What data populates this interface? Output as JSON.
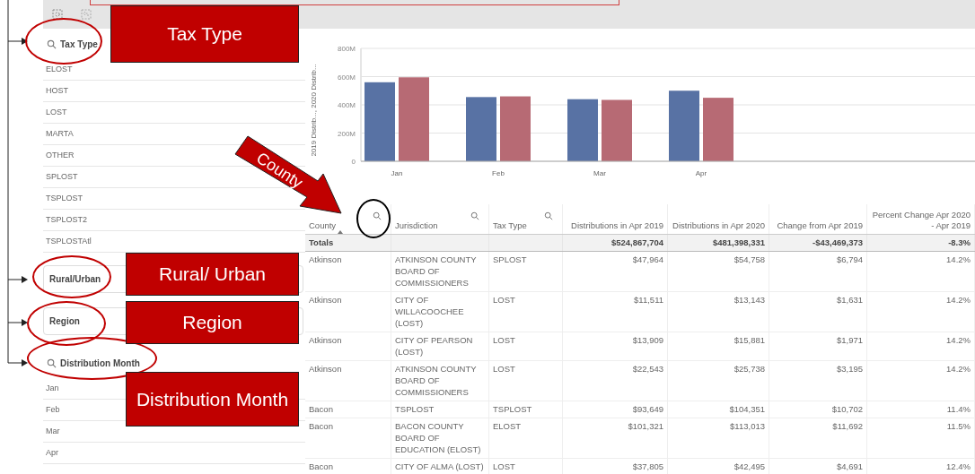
{
  "filters": [
    {
      "kind": "list",
      "title": "Tax Type",
      "items": [
        "ELOST",
        "HOST",
        "LOST",
        "MARTA",
        "OTHER",
        "SPLOST",
        "TSPLOST",
        "TSPLOST2",
        "TSPLOSTAtl"
      ]
    },
    {
      "kind": "dropdown",
      "title": "Rural/Urban"
    },
    {
      "kind": "dropdown",
      "title": "Region"
    },
    {
      "kind": "list",
      "title": "Distribution Month",
      "items": [
        "Jan",
        "Feb",
        "Mar",
        "Apr"
      ]
    }
  ],
  "chart": {
    "chart_data": {
      "type": "bar",
      "ylabel": "2019 Distrib..., 2020 Distrib...",
      "categories": [
        "Jan",
        "Feb",
        "Mar",
        "Apr"
      ],
      "series": [
        {
          "color": "#5872a4",
          "values": [
            560,
            455,
            440,
            500
          ]
        },
        {
          "color": "#b76a74",
          "values": [
            595,
            460,
            435,
            450
          ]
        }
      ],
      "ylim": [
        0,
        800
      ],
      "grid": true,
      "yticks": [
        {
          "value": 0,
          "label": "0"
        },
        {
          "value": 200,
          "label": "200M"
        },
        {
          "value": 400,
          "label": "400M"
        },
        {
          "value": 600,
          "label": "600M"
        },
        {
          "value": 800,
          "label": "800M"
        }
      ]
    }
  },
  "table": {
    "columns": [
      {
        "label": "County",
        "kind": "text",
        "search": true,
        "sorted": true
      },
      {
        "label": "Jurisdiction",
        "kind": "text",
        "search": true,
        "sorted": false
      },
      {
        "label": "Tax Type",
        "kind": "text",
        "search": true,
        "sorted": false
      },
      {
        "label": "Distributions in Apr 2019",
        "kind": "number",
        "search": false,
        "sorted": false
      },
      {
        "label": "Distributions in Apr 2020",
        "kind": "number",
        "search": false,
        "sorted": false
      },
      {
        "label": "Change from Apr 2019",
        "kind": "number",
        "search": false,
        "sorted": false
      },
      {
        "label": "Percent Change Apr 2020 - Apr 2019",
        "kind": "number",
        "search": false,
        "sorted": false
      }
    ],
    "totals": {
      "label": "Totals",
      "values": [
        "$524,867,704",
        "$481,398,331",
        "-$43,469,373",
        "-8.3%"
      ]
    },
    "rows": [
      [
        "Atkinson",
        "ATKINSON COUNTY BOARD OF COMMISSIONERS",
        "SPLOST",
        "$47,964",
        "$54,758",
        "$6,794",
        "14.2%"
      ],
      [
        "Atkinson",
        "CITY OF WILLACOOCHEE (LOST)",
        "LOST",
        "$11,511",
        "$13,143",
        "$1,631",
        "14.2%"
      ],
      [
        "Atkinson",
        "CITY OF PEARSON (LOST)",
        "LOST",
        "$13,909",
        "$15,881",
        "$1,971",
        "14.2%"
      ],
      [
        "Atkinson",
        "ATKINSON COUNTY BOARD OF COMMISSIONERS",
        "LOST",
        "$22,543",
        "$25,738",
        "$3,195",
        "14.2%"
      ],
      [
        "Bacon",
        "TSPLOST",
        "TSPLOST",
        "$93,649",
        "$104,351",
        "$10,702",
        "11.4%"
      ],
      [
        "Bacon",
        "BACON COUNTY BOARD OF EDUCATION (ELOST)",
        "ELOST",
        "$101,321",
        "$113,013",
        "$11,692",
        "11.5%"
      ],
      [
        "Bacon",
        "CITY OF ALMA (LOST)",
        "LOST",
        "$37,805",
        "$42,495",
        "$4,691",
        "12.4%"
      ]
    ]
  },
  "annotations": [
    {
      "kind": "box",
      "text": "Tax Type"
    },
    {
      "kind": "box",
      "text": "Rural/ Urban"
    },
    {
      "kind": "box",
      "text": "Region"
    },
    {
      "kind": "box",
      "text": "Distribution Month"
    },
    {
      "kind": "arrow",
      "text": "County"
    }
  ]
}
